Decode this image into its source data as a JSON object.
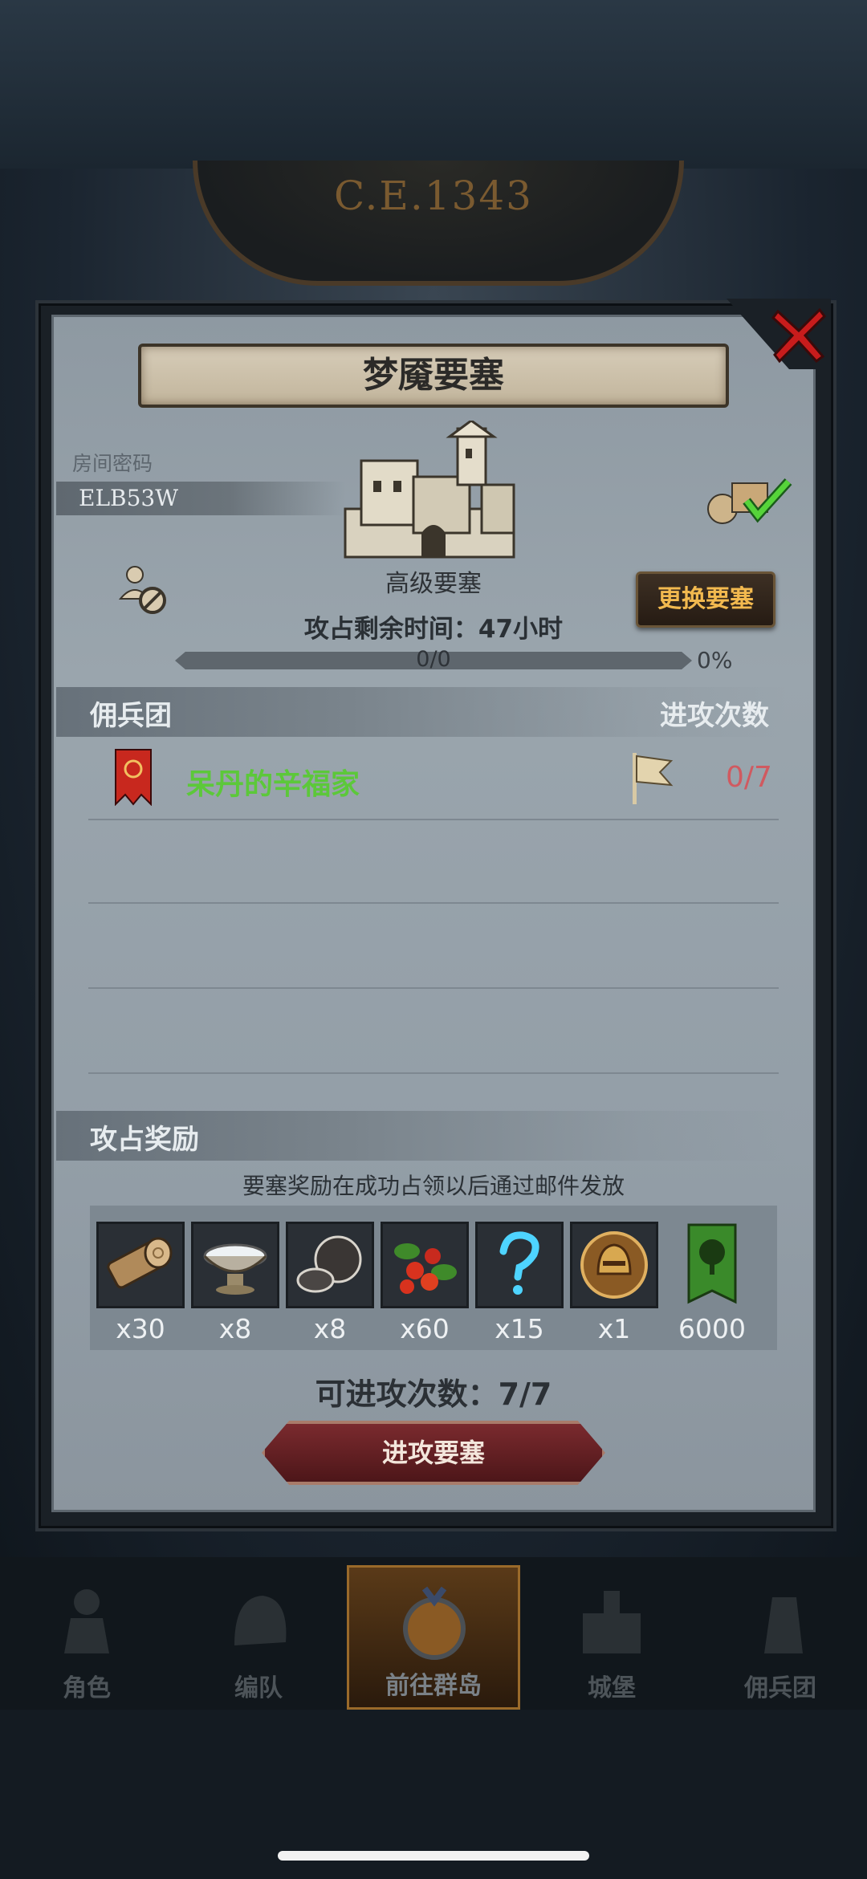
{
  "background": {
    "date_text": "C.E.1343"
  },
  "dialog": {
    "title": "梦魇要塞",
    "room_label": "房间密码",
    "room_code": "ELB53W",
    "fortress_name": "高级要塞",
    "time_label": "攻占剩余时间：47小时",
    "change_button": "更换要塞",
    "progress_text": "0/0",
    "progress_percent": "0%",
    "progress_value": 0
  },
  "mercenary": {
    "header_left": "佣兵团",
    "header_right": "进攻次数",
    "rows": [
      {
        "name": "呆丹的辛福家",
        "count": "0/7"
      }
    ]
  },
  "rewards": {
    "header": "攻占奖励",
    "note": "要塞奖励在成功占领以后通过邮件发放",
    "items": [
      {
        "icon": "wood-log-icon",
        "qty": "x30"
      },
      {
        "icon": "flour-bowl-icon",
        "qty": "x8"
      },
      {
        "icon": "truffle-icon",
        "qty": "x8"
      },
      {
        "icon": "berries-icon",
        "qty": "x60"
      },
      {
        "icon": "question-mark-icon",
        "qty": "x15"
      },
      {
        "icon": "knight-helmet-icon",
        "qty": "x1"
      },
      {
        "icon": "tree-banner-icon",
        "qty": "6000"
      }
    ],
    "remaining_attacks": "可进攻次数：7/7",
    "attack_button": "进攻要塞"
  },
  "nav": {
    "items": [
      {
        "label": "角色"
      },
      {
        "label": "编队"
      },
      {
        "label": "前往群岛"
      },
      {
        "label": "城堡"
      },
      {
        "label": "佣兵团"
      }
    ]
  },
  "colors": {
    "green_name": "#5cc83a",
    "count_red": "#d05a60",
    "button_gold": "#f2b94f"
  }
}
